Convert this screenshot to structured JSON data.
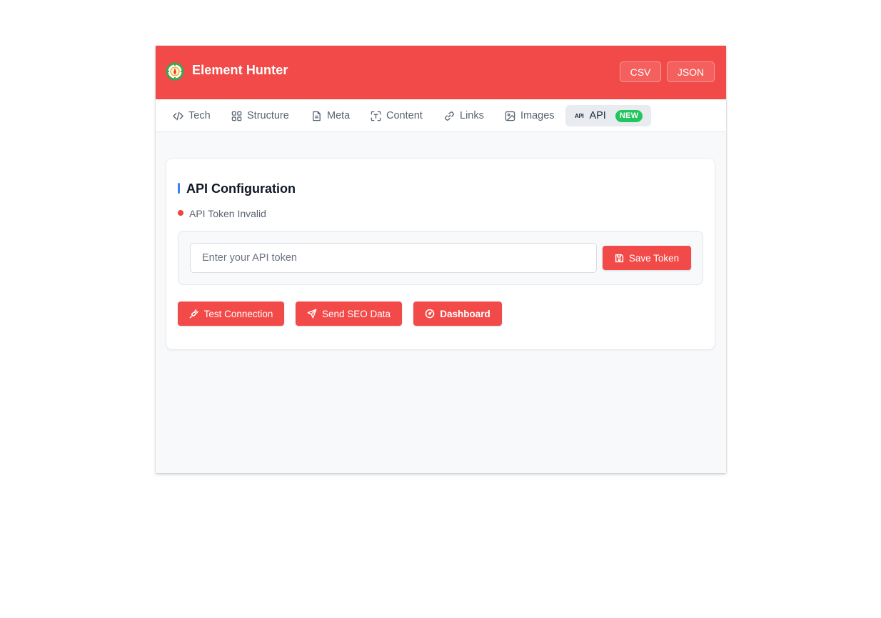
{
  "app": {
    "title": "Element Hunter",
    "export_buttons": [
      "CSV",
      "JSON"
    ]
  },
  "tabs": [
    {
      "label": "Tech",
      "icon": "code-icon"
    },
    {
      "label": "Structure",
      "icon": "grid-icon"
    },
    {
      "label": "Meta",
      "icon": "document-icon"
    },
    {
      "label": "Content",
      "icon": "text-scan-icon"
    },
    {
      "label": "Links",
      "icon": "link-icon"
    },
    {
      "label": "Images",
      "icon": "image-icon"
    },
    {
      "label": "API",
      "icon": "api-icon",
      "badge": "NEW",
      "active": true
    }
  ],
  "api_section": {
    "title": "API Configuration",
    "status": "API Token Invalid",
    "token_placeholder": "Enter your API token",
    "token_value": "",
    "save_label": "Save Token",
    "actions": [
      {
        "label": "Test Connection",
        "icon": "plug-icon"
      },
      {
        "label": "Send SEO Data",
        "icon": "send-icon"
      },
      {
        "label": "Dashboard",
        "icon": "gauge-icon"
      }
    ]
  },
  "colors": {
    "brand": "#f24a48",
    "status_error": "#ef4444",
    "accent": "#3b82f6",
    "badge_new": "#22c55e"
  }
}
